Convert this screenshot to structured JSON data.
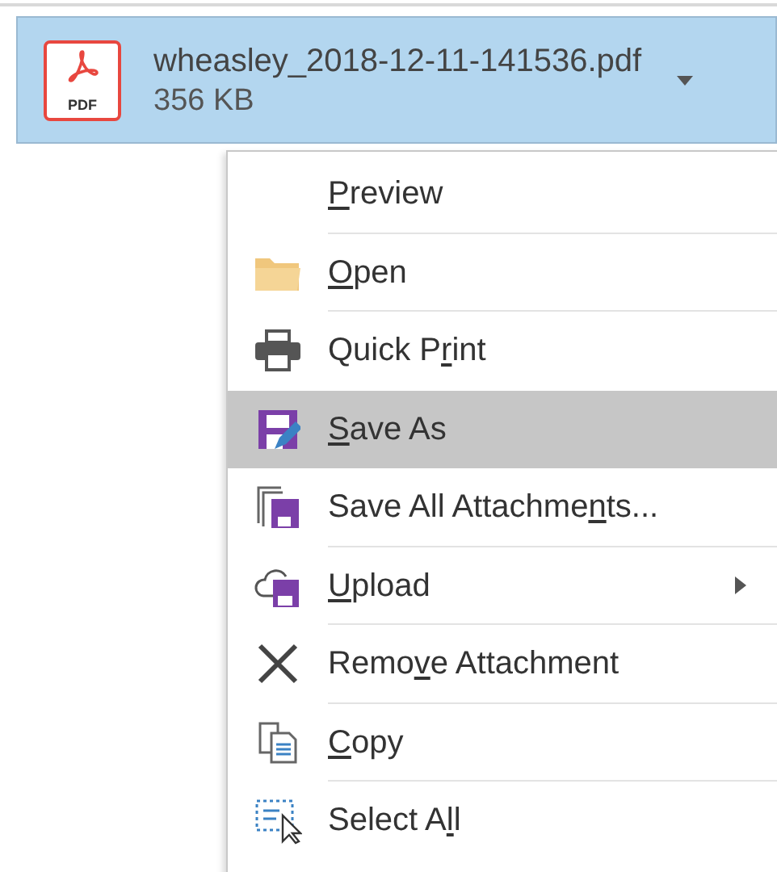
{
  "attachment": {
    "file_name": "wheasley_2018-12-11-141536.pdf",
    "size": "356 KB",
    "icon_text": "PDF"
  },
  "menu": {
    "items": [
      {
        "access_key": "P",
        "label_end": "review",
        "selected": false,
        "has_submenu": false
      },
      {
        "access_key": "O",
        "label_end": "pen",
        "selected": false,
        "has_submenu": false
      },
      {
        "label_start": "Quick P",
        "access_key": "r",
        "label_end": "int",
        "selected": false,
        "has_submenu": false
      },
      {
        "access_key": "S",
        "label_end": "ave As",
        "selected": true,
        "has_submenu": false
      },
      {
        "label_start": "Save All Attachme",
        "access_key": "n",
        "label_end": "ts...",
        "selected": false,
        "has_submenu": false
      },
      {
        "access_key": "U",
        "label_end": "pload",
        "selected": false,
        "has_submenu": true
      },
      {
        "label_start": "Remo",
        "access_key": "v",
        "label_end": "e Attachment",
        "selected": false,
        "has_submenu": false
      },
      {
        "access_key": "C",
        "label_end": "opy",
        "selected": false,
        "has_submenu": false
      },
      {
        "label_start": "Select A",
        "access_key": "l",
        "label_end": "l",
        "selected": false,
        "has_submenu": false
      }
    ]
  }
}
